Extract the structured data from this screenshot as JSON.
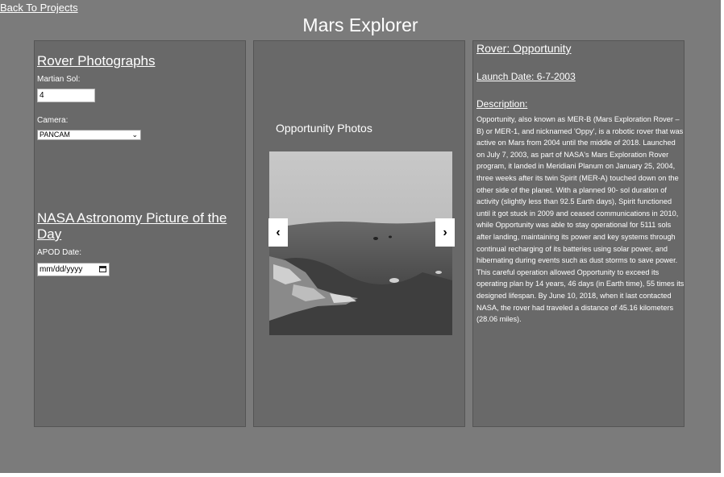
{
  "nav": {
    "back_link": "Back To Projects"
  },
  "header": {
    "title": "Mars Explorer"
  },
  "left_panel": {
    "rover_section": {
      "heading": "Rover Photographs",
      "sol_label": "Martian Sol:",
      "sol_value": "4",
      "camera_label": "Camera:",
      "camera_value": "PANCAM"
    },
    "apod_section": {
      "heading": "NASA Astronomy Picture of the Day",
      "date_label": "APOD Date:",
      "date_placeholder": "mm/dd/yyyy"
    }
  },
  "gallery": {
    "title": "Opportunity Photos",
    "prev_label": "‹",
    "next_label": "›"
  },
  "rover_info": {
    "name": "Rover: Opportunity",
    "launch_date": "Launch Date: 6-7-2003",
    "description_heading": "Description:",
    "description": "Opportunity, also known as MER-B (Mars Exploration Rover – B) or MER-1, and nicknamed 'Oppy', is a robotic rover that was active on Mars from 2004 until the middle of 2018. Launched on July 7, 2003, as part of NASA's Mars Exploration Rover program, it landed in Meridiani Planum on January 25, 2004, three weeks after its twin Spirit (MER-A) touched down on the other side of the planet. With a planned 90- sol duration of activity (slightly less than 92.5 Earth days), Spirit functioned until it got stuck in 2009 and ceased communications in 2010, while Opportunity was able to stay operational for 5111 sols after landing, maintaining its power and key systems through continual recharging of its batteries using solar power, and hibernating during events such as dust storms to save power. This careful operation allowed Opportunity to exceed its operating plan by 14 years, 46 days (in Earth time), 55 times its designed lifespan. By June 10, 2018, when it last contacted NASA, the rover had traveled a distance of 45.16 kilometers (28.06 miles)."
  },
  "colors": {
    "page_background": "#7b7b7b",
    "panel_background": "#696969",
    "text": "#ffffff"
  },
  "icons": {
    "camera_dropdown": "chevron-down-icon",
    "date_picker": "calendar-icon",
    "prev": "chevron-left-icon",
    "next": "chevron-right-icon"
  }
}
